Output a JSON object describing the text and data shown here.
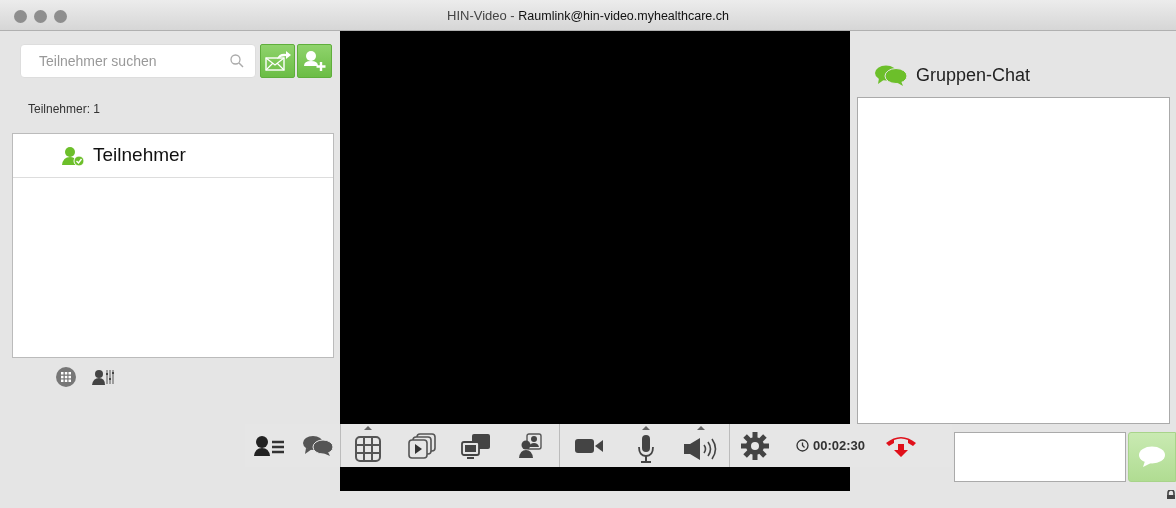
{
  "window": {
    "title": "HIN-Video - ",
    "room_link": "Raumlink@hin-video.myhealthcare.ch"
  },
  "search": {
    "placeholder": "Teilnehmer suchen"
  },
  "participant_count": "Teilnehmer: 1",
  "participants": [
    {
      "name": "Teilnehmer"
    }
  ],
  "chat": {
    "title": "Gruppen-Chat"
  },
  "toolbar": {
    "timer": "00:02:30"
  }
}
